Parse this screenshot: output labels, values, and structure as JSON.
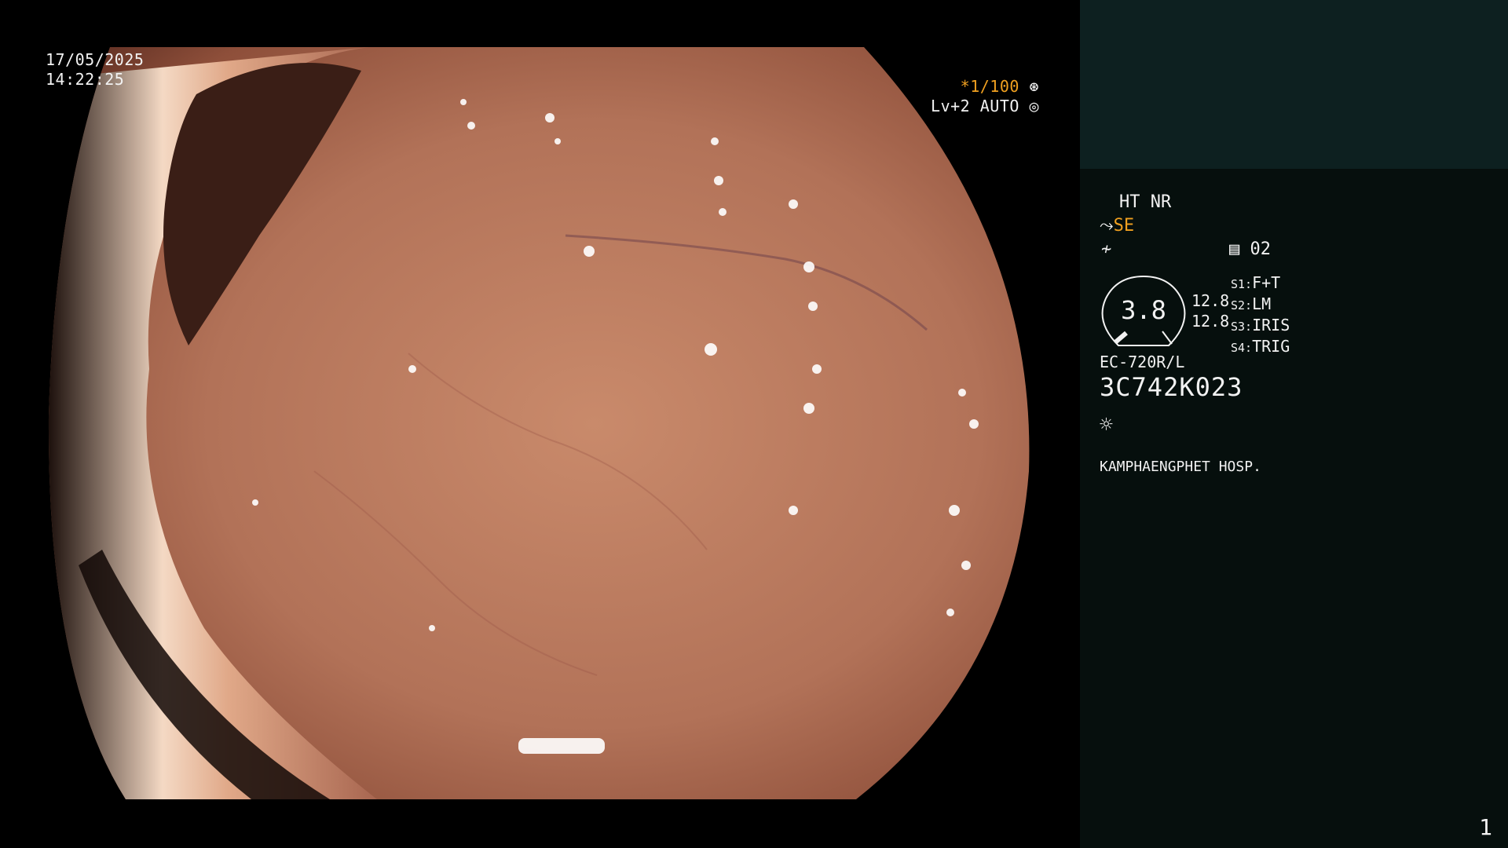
{
  "osd": {
    "date": "17/05/2025",
    "time": "14:22:25",
    "shutter_speed": "*1/100",
    "shutter_icon": "aperture-icon",
    "level": "Lv+2 AUTO",
    "auto_icon": "iris-icon"
  },
  "sidebar": {
    "mode": "HT NR",
    "structure_icon": "structure-enhance-icon",
    "structure_mode": "SE",
    "contrast_icon": "contrast-icon",
    "memory_icon": "memory-icon",
    "memory_value": "02",
    "gauge": {
      "value": "3.8",
      "scale_top": "12.8",
      "scale_bottom": "12.8"
    },
    "switches": [
      {
        "key": "S1:",
        "value": "F+T"
      },
      {
        "key": "S2:",
        "value": "LM"
      },
      {
        "key": "S3:",
        "value": "IRIS"
      },
      {
        "key": "S4:",
        "value": "TRIG"
      }
    ],
    "scope_model": "EC-720R/L",
    "scope_serial": "3C742K023",
    "light_icon": "brightness-icon",
    "hospital": "KAMPHAENGPHET HOSP."
  },
  "page_number": "1",
  "colors": {
    "accent": "#f0a020",
    "sidebar_top": "#0d2020",
    "sidebar": "#060f0d"
  }
}
